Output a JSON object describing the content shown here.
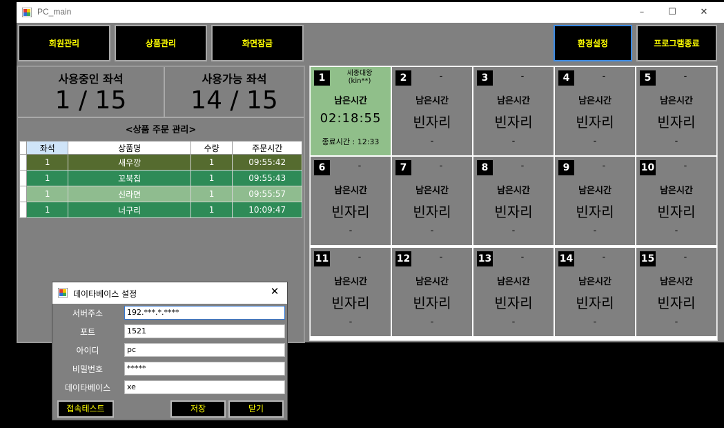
{
  "window": {
    "title": "PC_main",
    "controls": {
      "minimize": "–",
      "maximize": "☐",
      "close": "✕"
    }
  },
  "toolbar": {
    "member_mgmt": "회원관리",
    "product_mgmt": "상품관리",
    "screen_lock": "화면잠금",
    "settings": "환경설정",
    "exit_program": "프로그램종료"
  },
  "stats": {
    "in_use_label": "사용중인 좌석",
    "in_use_value": "1 / 15",
    "available_label": "사용가능 좌석",
    "available_value": "14 / 15"
  },
  "orders": {
    "title": "<상품 주문 관리>",
    "columns": [
      "좌석",
      "상품명",
      "수량",
      "주문시간"
    ],
    "rows": [
      {
        "seat": "1",
        "product": "새우깡",
        "qty": "1",
        "time": "09:55:42",
        "color": "#556b2f"
      },
      {
        "seat": "1",
        "product": "꼬북칩",
        "qty": "1",
        "time": "09:55:43",
        "color": "#2e8b57"
      },
      {
        "seat": "1",
        "product": "신라면",
        "qty": "1",
        "time": "09:55:57",
        "color": "#8fbc8f"
      },
      {
        "seat": "1",
        "product": "너구리",
        "qty": "1",
        "time": "10:09:47",
        "color": "#2e8b57"
      }
    ]
  },
  "seats": [
    {
      "num": "1",
      "user": "세종대왕\n(kin**)",
      "remain_label": "남은시간",
      "remain": "02:18:55",
      "end": "종료시간 : 12:33",
      "active": true
    },
    {
      "num": "2",
      "user": "-",
      "remain_label": "남은시간",
      "remain": "빈자리",
      "end": "-",
      "active": false
    },
    {
      "num": "3",
      "user": "-",
      "remain_label": "남은시간",
      "remain": "빈자리",
      "end": "-",
      "active": false
    },
    {
      "num": "4",
      "user": "-",
      "remain_label": "남은시간",
      "remain": "빈자리",
      "end": "-",
      "active": false
    },
    {
      "num": "5",
      "user": "-",
      "remain_label": "남은시간",
      "remain": "빈자리",
      "end": "-",
      "active": false
    },
    {
      "num": "6",
      "user": "-",
      "remain_label": "남은시간",
      "remain": "빈자리",
      "end": "-",
      "active": false
    },
    {
      "num": "7",
      "user": "-",
      "remain_label": "남은시간",
      "remain": "빈자리",
      "end": "-",
      "active": false
    },
    {
      "num": "8",
      "user": "-",
      "remain_label": "남은시간",
      "remain": "빈자리",
      "end": "-",
      "active": false
    },
    {
      "num": "9",
      "user": "-",
      "remain_label": "남은시간",
      "remain": "빈자리",
      "end": "-",
      "active": false
    },
    {
      "num": "10",
      "user": "-",
      "remain_label": "남은시간",
      "remain": "빈자리",
      "end": "-",
      "active": false
    },
    {
      "num": "11",
      "user": "-",
      "remain_label": "남은시간",
      "remain": "빈자리",
      "end": "-",
      "active": false
    },
    {
      "num": "12",
      "user": "-",
      "remain_label": "남은시간",
      "remain": "빈자리",
      "end": "-",
      "active": false
    },
    {
      "num": "13",
      "user": "-",
      "remain_label": "남은시간",
      "remain": "빈자리",
      "end": "-",
      "active": false
    },
    {
      "num": "14",
      "user": "-",
      "remain_label": "남은시간",
      "remain": "빈자리",
      "end": "-",
      "active": false
    },
    {
      "num": "15",
      "user": "-",
      "remain_label": "남은시간",
      "remain": "빈자리",
      "end": "-",
      "active": false
    }
  ],
  "db_dialog": {
    "title": "데이타베이스 설정",
    "close": "✕",
    "fields": [
      {
        "label": "서버주소",
        "value": "192.***.*.****"
      },
      {
        "label": "포트",
        "value": "1521"
      },
      {
        "label": "아이디",
        "value": "pc"
      },
      {
        "label": "비밀번호",
        "value": "*****"
      },
      {
        "label": "데이타베이스",
        "value": "xe"
      }
    ],
    "test_button": "접속테스트",
    "save_button": "저장",
    "close_button": "닫기"
  },
  "colors": {
    "window_bg": "#808080",
    "button_text": "#ffff00",
    "active_seat": "#90bf8a",
    "focus_border": "#3c8ce6"
  }
}
